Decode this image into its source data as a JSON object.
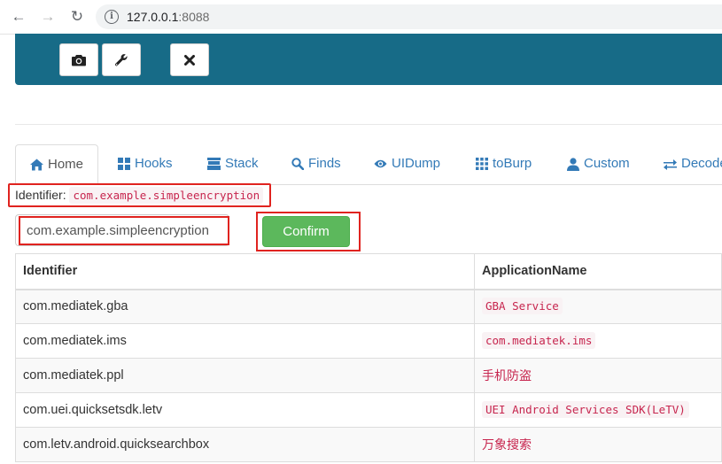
{
  "browser": {
    "url_host": "127.0.0.1",
    "url_port": ":8088"
  },
  "toolbar": {
    "buttons": [
      {
        "icon": "camera-icon"
      },
      {
        "icon": "wrench-icon"
      },
      {
        "icon": "close-icon"
      }
    ]
  },
  "tabs": [
    {
      "label": "Home",
      "icon": "home-icon",
      "active": true
    },
    {
      "label": "Hooks",
      "icon": "grid-icon"
    },
    {
      "label": "Stack",
      "icon": "stack-icon"
    },
    {
      "label": "Finds",
      "icon": "search-icon"
    },
    {
      "label": "UIDump",
      "icon": "eye-icon"
    },
    {
      "label": "toBurp",
      "icon": "apps-icon"
    },
    {
      "label": "Custom",
      "icon": "user-icon"
    },
    {
      "label": "Decode",
      "icon": "transfer-icon"
    }
  ],
  "identifier": {
    "label": "Identifier:",
    "value": "com.example.simpleencryption"
  },
  "form": {
    "input_value": "com.example.simpleencryption",
    "confirm_label": "Confirm"
  },
  "table": {
    "headers": [
      "Identifier",
      "ApplicationName"
    ],
    "rows": [
      {
        "identifier": "com.mediatek.gba",
        "name": "GBA Service"
      },
      {
        "identifier": "com.mediatek.ims",
        "name": "com.mediatek.ims"
      },
      {
        "identifier": "com.mediatek.ppl",
        "name": "手机防盗"
      },
      {
        "identifier": "com.uei.quicksetsdk.letv",
        "name": "UEI Android Services SDK(LeTV)"
      },
      {
        "identifier": "com.letv.android.quicksearchbox",
        "name": "万象搜索"
      }
    ]
  },
  "colors": {
    "header_bg": "#176b87",
    "link": "#337ab7",
    "confirm": "#5cb85c",
    "highlight": "#e0231f",
    "code": "#c7254e"
  }
}
